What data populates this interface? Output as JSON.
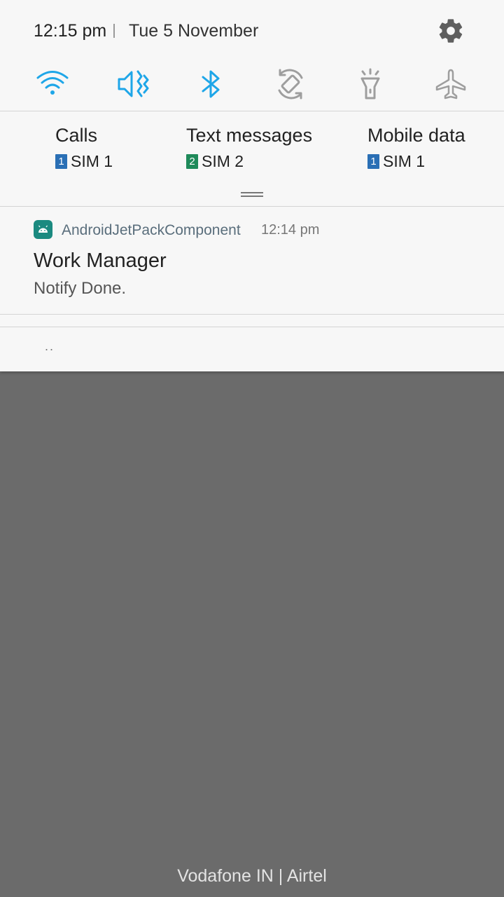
{
  "status": {
    "time": "12:15 pm",
    "date": "Tue 5 November"
  },
  "colors": {
    "accent": "#1ea6e8",
    "inactive": "#9e9e9e",
    "sim1": "#2a6fb5",
    "sim2": "#1f8a5a",
    "app_icon": "#1b8a80"
  },
  "quick_settings": [
    {
      "icon": "wifi-icon",
      "active": true
    },
    {
      "icon": "vibrate-icon",
      "active": true
    },
    {
      "icon": "bluetooth-icon",
      "active": true
    },
    {
      "icon": "auto-rotate-icon",
      "active": false
    },
    {
      "icon": "flashlight-icon",
      "active": false
    },
    {
      "icon": "airplane-mode-icon",
      "active": false
    }
  ],
  "sim": {
    "calls": {
      "title": "Calls",
      "badge": "1",
      "label": "SIM 1"
    },
    "text": {
      "title": "Text messages",
      "badge": "2",
      "label": "SIM 2"
    },
    "data": {
      "title": "Mobile data",
      "badge": "1",
      "label": "SIM 1"
    }
  },
  "notification": {
    "app": "AndroidJetPackComponent",
    "time": "12:14 pm",
    "title": "Work Manager",
    "text": "Notify Done."
  },
  "more_indicator": "..",
  "carrier": "Vodafone IN | Airtel"
}
